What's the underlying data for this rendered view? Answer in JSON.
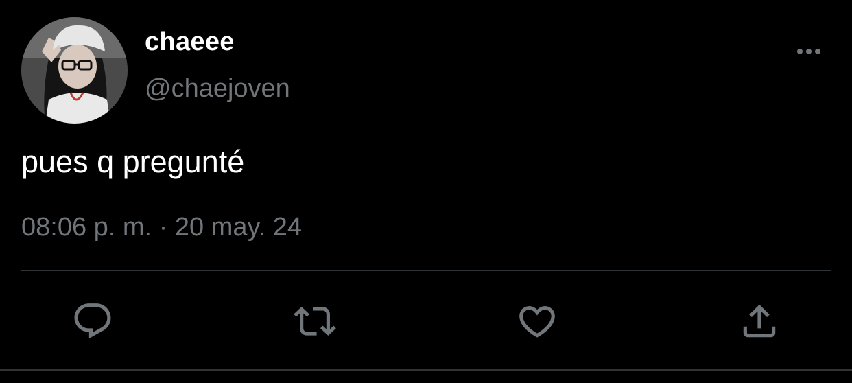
{
  "tweet": {
    "author": {
      "display_name": "chaeee",
      "handle": "@chaejoven"
    },
    "text": "pues q pregunté",
    "timestamp": "08:06 p. m. · 20 may. 24"
  },
  "icons": {
    "more": "more-horizontal-icon",
    "reply": "reply-icon",
    "retweet": "retweet-icon",
    "like": "heart-icon",
    "share": "share-icon"
  },
  "colors": {
    "background": "#000000",
    "primary_text": "#ffffff",
    "secondary_text": "#71767b",
    "divider": "#2f3336"
  }
}
